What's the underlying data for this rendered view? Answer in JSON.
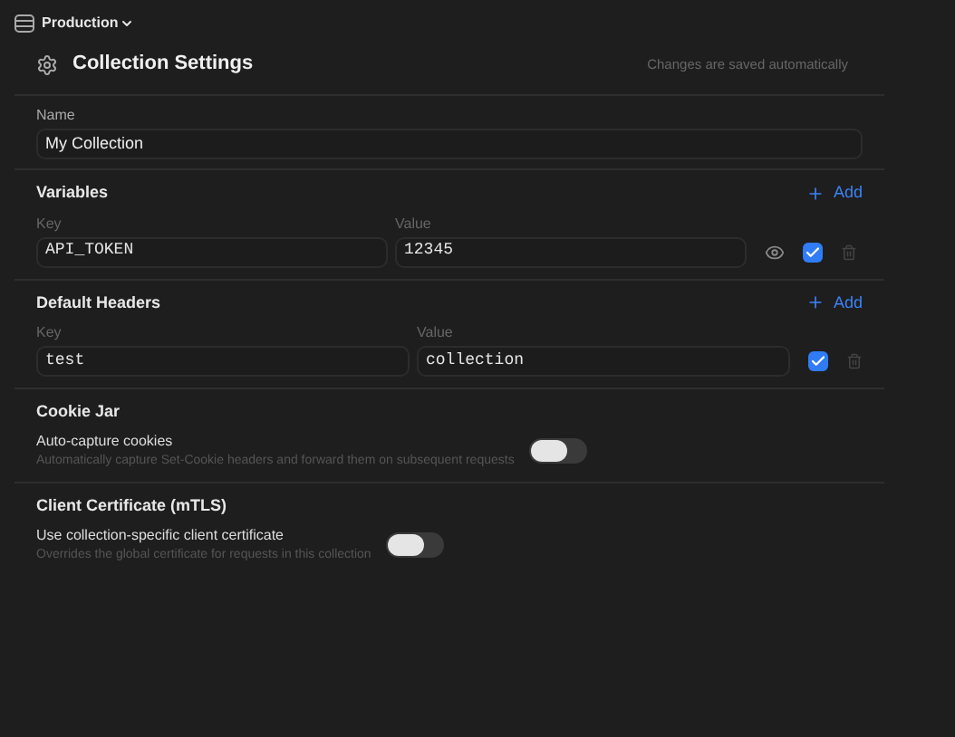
{
  "workspace": {
    "label": "Production"
  },
  "header": {
    "title": "Collection Settings",
    "note": "Changes are saved automatically"
  },
  "name_field": {
    "label": "Name",
    "value": "My Collection"
  },
  "variables": {
    "title": "Variables",
    "add": "Add",
    "key_label": "Key",
    "value_label": "Value",
    "rows": [
      {
        "key": "API_TOKEN",
        "value": "12345",
        "checked": true
      }
    ]
  },
  "headers": {
    "title": "Default Headers",
    "add": "Add",
    "key_label": "Key",
    "value_label": "Value",
    "rows": [
      {
        "key": "test",
        "value": "collection",
        "checked": true
      }
    ]
  },
  "sections": [
    {
      "title": "Cookie Jar",
      "label": "Auto-capture cookies",
      "description": "Automatically capture Set-Cookie headers and forward them on subsequent requests",
      "on": false
    },
    {
      "title": "Client Certificate (mTLS)",
      "label": "Use collection-specific client certificate",
      "description": "Overrides the global certificate for requests in this collection",
      "on": false
    }
  ]
}
